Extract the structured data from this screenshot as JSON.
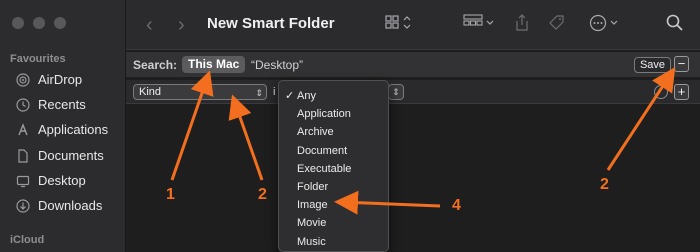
{
  "sidebar": {
    "section_favourites": "Favourites",
    "items": [
      {
        "label": "AirDrop",
        "icon": "airdrop-icon"
      },
      {
        "label": "Recents",
        "icon": "clock-icon"
      },
      {
        "label": "Applications",
        "icon": "applications-icon"
      },
      {
        "label": "Documents",
        "icon": "document-icon"
      },
      {
        "label": "Desktop",
        "icon": "desktop-icon"
      },
      {
        "label": "Downloads",
        "icon": "download-icon"
      }
    ],
    "section_icloud": "iCloud"
  },
  "toolbar": {
    "title": "New Smart Folder",
    "back_icon": "chevron-left-icon",
    "forward_icon": "chevron-right-icon"
  },
  "search": {
    "label": "Search:",
    "scope_selected": "This Mac",
    "scope_other": "“Desktop”",
    "save_label": "Save",
    "minus_label": "−"
  },
  "criteria": {
    "attribute": "Kind",
    "operator_partial": "i",
    "plus_label": "+"
  },
  "dropdown": {
    "items": [
      {
        "label": "Any",
        "checked": true
      },
      {
        "label": "Application",
        "checked": false
      },
      {
        "label": "Archive",
        "checked": false
      },
      {
        "label": "Document",
        "checked": false
      },
      {
        "label": "Executable",
        "checked": false
      },
      {
        "label": "Folder",
        "checked": false
      },
      {
        "label": "Image",
        "checked": false
      },
      {
        "label": "Movie",
        "checked": false
      },
      {
        "label": "Music",
        "checked": false
      }
    ],
    "check_mark": "✓"
  },
  "annotations": {
    "color": "#f36f1f",
    "labels": [
      "1",
      "2",
      "2",
      "4"
    ]
  },
  "colors": {
    "window_bg": "#1e1e1e",
    "sidebar_bg": "#2c2c2e",
    "annotation": "#f36f1f"
  }
}
